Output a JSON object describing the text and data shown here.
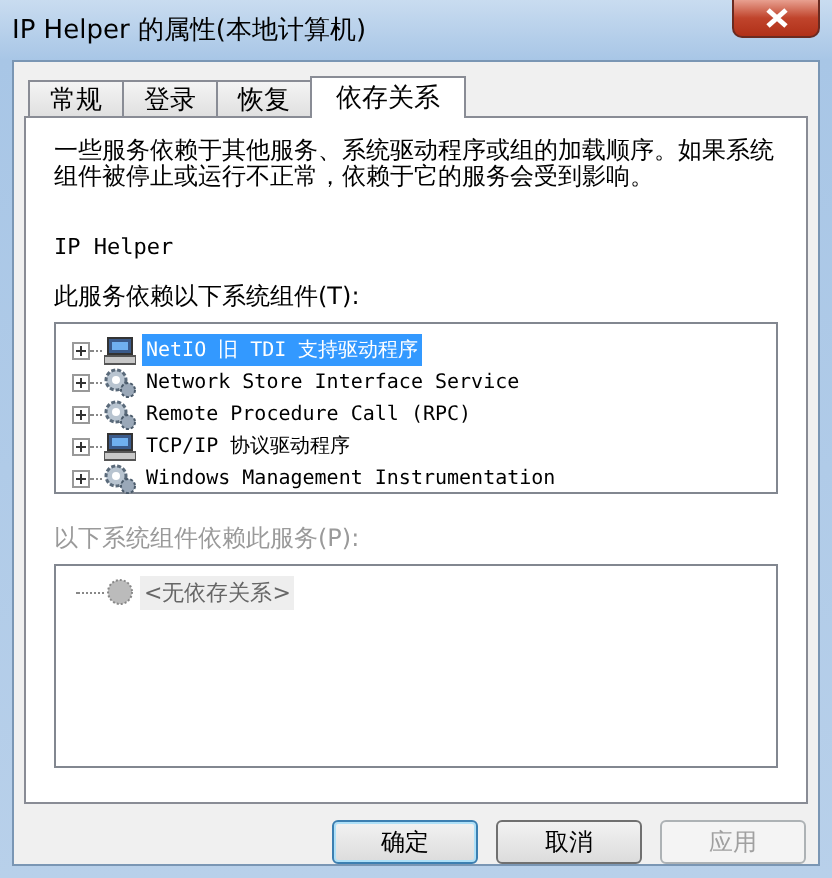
{
  "window": {
    "title": "IP Helper 的属性(本地计算机)"
  },
  "tabs": [
    {
      "label": "常规",
      "selected": false
    },
    {
      "label": "登录",
      "selected": false
    },
    {
      "label": "恢复",
      "selected": false
    },
    {
      "label": "依存关系",
      "selected": true
    }
  ],
  "description": "一些服务依赖于其他服务、系统驱动程序或组的加载顺序。如果系统组件被停止或运行不正常，依赖于它的服务会受到影响。",
  "service_name": "IP Helper",
  "depends_on": {
    "label": "此服务依赖以下系统组件(T):",
    "disabled": false,
    "items": [
      {
        "label": "NetIO 旧 TDI 支持驱动程序",
        "kind": "driver",
        "selected": true,
        "expandable": true
      },
      {
        "label": "Network Store Interface Service",
        "kind": "service",
        "selected": false,
        "expandable": true
      },
      {
        "label": "Remote Procedure Call (RPC)",
        "kind": "service",
        "selected": false,
        "expandable": true
      },
      {
        "label": "TCP/IP 协议驱动程序",
        "kind": "driver",
        "selected": false,
        "expandable": true
      },
      {
        "label": "Windows Management Instrumentation",
        "kind": "service",
        "selected": false,
        "expandable": true
      }
    ]
  },
  "dependents": {
    "label": "以下系统组件依赖此服务(P):",
    "disabled": true,
    "items": [
      {
        "label": "<无依存关系>",
        "kind": "none",
        "selected": false,
        "expandable": false
      }
    ]
  },
  "buttons": [
    {
      "label": "确定",
      "disabled": false
    },
    {
      "label": "取消",
      "disabled": false
    },
    {
      "label": "应用",
      "disabled": true
    }
  ]
}
